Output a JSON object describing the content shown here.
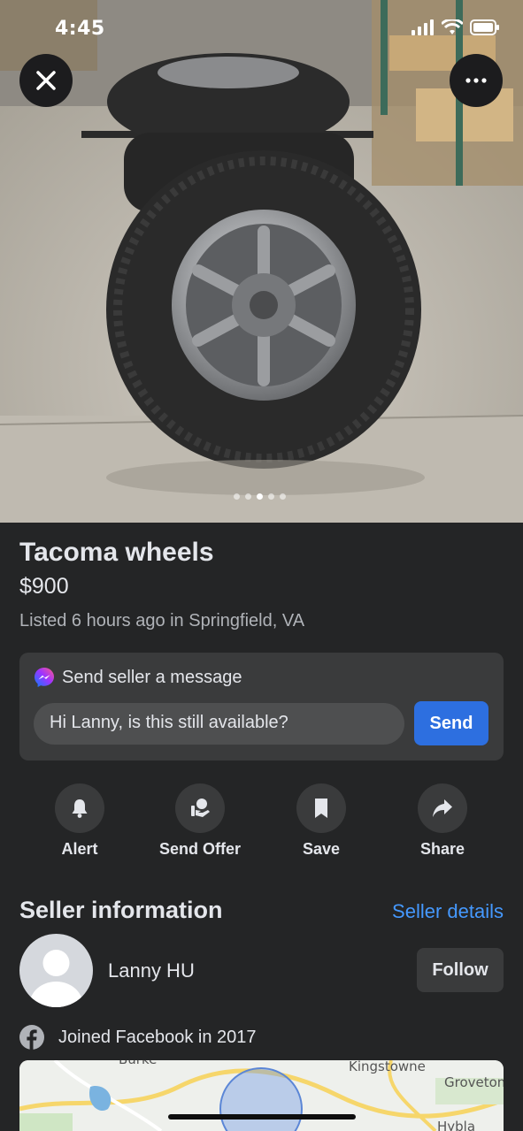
{
  "status_bar": {
    "time": "4:45"
  },
  "photo": {
    "page_count": 5,
    "active_page": 3
  },
  "listing": {
    "title": "Tacoma wheels",
    "price": "$900",
    "listed": "Listed 6 hours ago in Springfield, VA"
  },
  "message": {
    "header": "Send seller a message",
    "input_value": "Hi Lanny, is this still available?",
    "send_label": "Send"
  },
  "actions": [
    {
      "label": "Alert",
      "icon": "bell-icon"
    },
    {
      "label": "Send Offer",
      "icon": "send-offer-icon"
    },
    {
      "label": "Save",
      "icon": "bookmark-icon"
    },
    {
      "label": "Share",
      "icon": "share-arrow-icon"
    }
  ],
  "seller": {
    "section_title": "Seller information",
    "details_link": "Seller details",
    "name": "Lanny HU",
    "follow_label": "Follow",
    "joined": "Joined Facebook in 2017"
  },
  "map": {
    "labels": [
      "Burke",
      "Kingstowne",
      "Groveton",
      "Hybla Valley"
    ]
  },
  "colors": {
    "background": "#242526",
    "card": "#3a3b3c",
    "accent": "#2d6fe0",
    "link": "#4599ff"
  }
}
